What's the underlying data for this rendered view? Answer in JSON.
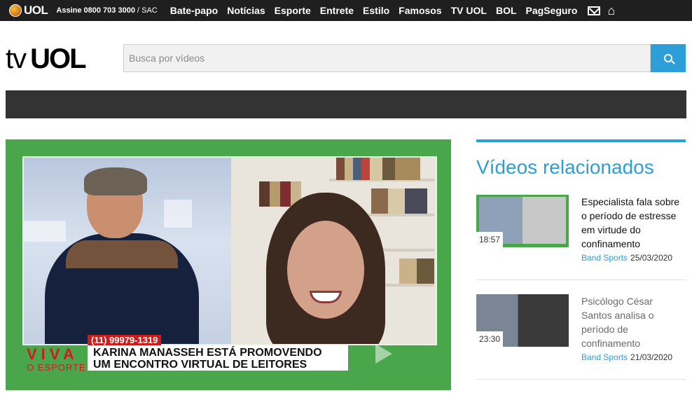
{
  "topbar": {
    "brand": "UOL",
    "assine_label": "Assine",
    "phone": "0800 703 3000",
    "sac": "/ SAC",
    "nav": [
      "Bate-papo",
      "Notícias",
      "Esporte",
      "Entrete",
      "Estilo",
      "Famosos",
      "TV UOL",
      "BOL",
      "PagSeguro"
    ],
    "icons": [
      "mail-icon",
      "home-icon"
    ]
  },
  "header": {
    "logo_tv": "tv",
    "logo_uol": "UOL",
    "search_placeholder": "Busca por vídeos",
    "search_icon": "search-icon"
  },
  "video": {
    "phone_tag": "(11) 99979-1319",
    "caption_line1": "KARINA MANASSEH ESTÁ PROMOVENDO",
    "caption_line2": "UM ENCONTRO VIRTUAL DE LEITORES",
    "program_logo_1": "VIVA",
    "program_logo_2": "O ESPORTE"
  },
  "sidebar": {
    "title": "Vídeos relacionados",
    "items": [
      {
        "duration": "18:57",
        "title": "Especialista fala sobre o período de estresse em virtude do confinamento",
        "source": "Band Sports",
        "date": "25/03/2020"
      },
      {
        "duration": "23:30",
        "title": "Psicólogo César Santos analisa o período de confinamento",
        "source": "Band Sports",
        "date": "21/03/2020"
      }
    ]
  },
  "colors": {
    "accent": "#2e9ed8",
    "topbar": "#1f1f1f",
    "darkbar": "#333333",
    "video_green": "#4aa64a",
    "caption_red": "#cc1d1d"
  }
}
